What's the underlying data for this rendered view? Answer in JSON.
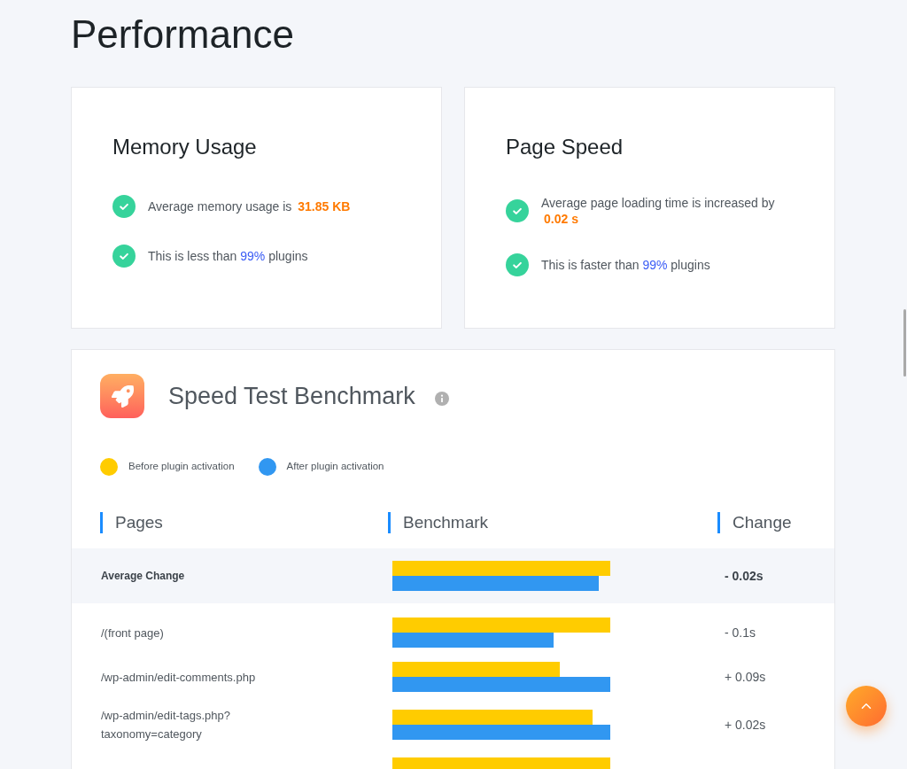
{
  "page_title": "Performance",
  "summary_cards": [
    {
      "title": "Memory Usage",
      "items": [
        {
          "parts": [
            {
              "text": "Average memory usage is",
              "kind": "plain"
            },
            {
              "text": "31.85 KB",
              "kind": "metric"
            }
          ]
        },
        {
          "parts": [
            {
              "text": "This is less than",
              "kind": "plain"
            },
            {
              "text": "99%",
              "kind": "percent"
            },
            {
              "text": "plugins",
              "kind": "plain"
            }
          ]
        }
      ]
    },
    {
      "title": "Page Speed",
      "items": [
        {
          "parts": [
            {
              "text": "Average page loading time is increased by",
              "kind": "plain"
            },
            {
              "text": "0.02 s",
              "kind": "metric"
            }
          ]
        },
        {
          "parts": [
            {
              "text": "This is faster than",
              "kind": "plain"
            },
            {
              "text": "99%",
              "kind": "percent"
            },
            {
              "text": "plugins",
              "kind": "plain"
            }
          ]
        }
      ]
    }
  ],
  "benchmark": {
    "title": "Speed Test Benchmark",
    "legend": [
      {
        "label": "Before plugin activation",
        "color": "#ffcc00"
      },
      {
        "label": "After plugin activation",
        "color": "#3197f1"
      }
    ],
    "columns": [
      "Pages",
      "Benchmark",
      "Change"
    ],
    "rows": [
      {
        "kind": "average",
        "page": "Average Change",
        "change": "- 0.02s"
      },
      {
        "kind": "page",
        "page": "/(front page)",
        "change": "- 0.1s"
      },
      {
        "kind": "page",
        "page": "/wp-admin/edit-comments.php",
        "change": "+ 0.09s"
      },
      {
        "kind": "page",
        "page": "/wp-admin/edit-tags.php?taxonomy=category",
        "change": "+ 0.02s"
      },
      {
        "kind": "page"
      }
    ]
  }
}
